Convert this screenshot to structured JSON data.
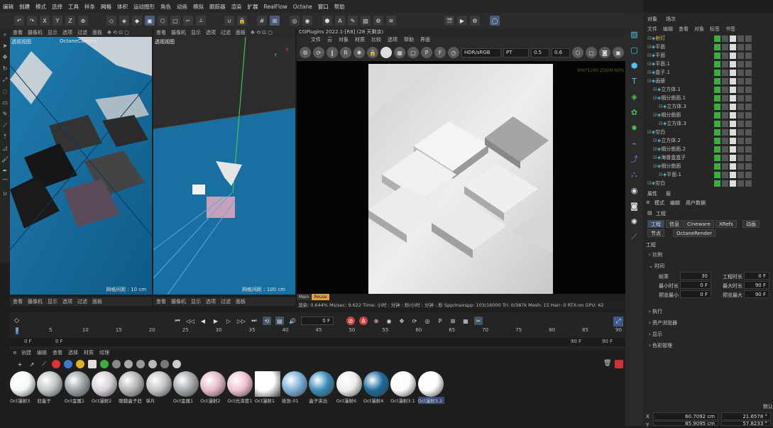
{
  "menubar": {
    "items": [
      "编辑",
      "创建",
      "模式",
      "选择",
      "工具",
      "样条",
      "网格",
      "体积",
      "运动图形",
      "角色",
      "动画",
      "模拟",
      "跟踪器",
      "渲染",
      "扩展",
      "RealFlow",
      "Octane",
      "窗口",
      "帮助"
    ]
  },
  "viewport_menu": [
    "查看",
    "摄像机",
    "显示",
    "选项",
    "过滤",
    "面板"
  ],
  "viewport1": {
    "label": "透视视图",
    "camera": "OctaneCamera",
    "grid": "网格间距 : 10 cm"
  },
  "viewport2": {
    "label": "透视视图",
    "grid": "网格间距 : 100 cm"
  },
  "render": {
    "title": "CGPlugins   2022.1-[R8] (28 天剩余)",
    "menu": [
      "文件",
      "云",
      "对象",
      "材质",
      "比较",
      "选项",
      "帮助",
      "界面"
    ],
    "color_space": "HDR/sRGB",
    "mode": "PT",
    "val1": "0.5",
    "val2": "0.6",
    "resolution": "900*1200 ZOOM:60%",
    "tabs": [
      "Main",
      "Reuse"
    ],
    "status": "渲染: 0.644%   Ms/sec: 9.622   Time: 小时 : 分钟 : 秒/小时 : 分钟 : 秒   Spp/maxspp: 103/16000   Tri: 0/387k   Mesh: 15   Hair: 0   RTX:on   GPU: 62"
  },
  "timeline": {
    "frame_current": "0 F",
    "ruler": [
      "0",
      "5",
      "10",
      "15",
      "20",
      "25",
      "30",
      "35",
      "40",
      "45",
      "50",
      "55",
      "60",
      "65",
      "70",
      "75",
      "80",
      "85",
      "90"
    ],
    "start": "0 F",
    "start2": "0 F",
    "end": "90 F",
    "end2": "90 F"
  },
  "materials_menu": [
    "创建",
    "编辑",
    "查看",
    "选择",
    "材质",
    "纹理"
  ],
  "materials": [
    {
      "name": "Oct漫射3",
      "color": "#f4f7f9"
    },
    {
      "name": "旧盒子",
      "color": "#bfc4c6"
    },
    {
      "name": "Oct金属1",
      "color": "#9aa0a4"
    },
    {
      "name": "Oct漫射2",
      "color": "#d8cfd8"
    },
    {
      "name": "眼膜盒子旧",
      "color": "#b3b3b3"
    },
    {
      "name": "单片",
      "color": "#c0c2c4"
    },
    {
      "name": "Oct金属1",
      "color": "#a4a8ab"
    },
    {
      "name": "Oct漫射2",
      "color": "#e5b8c6"
    },
    {
      "name": "Oct光泽度1",
      "color": "#f0c0d2"
    },
    {
      "name": "Oct漫射1",
      "color": "#ffffff"
    },
    {
      "name": "纸张-01",
      "color": "#7aaed8"
    },
    {
      "name": "盒子夹出",
      "color": "#3a8ab8"
    },
    {
      "name": "Oct漫射6",
      "color": "#ededea"
    },
    {
      "name": "Oct漫射4",
      "color": "#1a6a9c"
    },
    {
      "name": "Oct漫射3.1",
      "color": "#fbfbfb"
    },
    {
      "name": "Oct漫射3.2",
      "color": "#fdfdfd"
    }
  ],
  "objects": {
    "tabs": [
      "对象",
      "场次"
    ],
    "menu": [
      "文件",
      "编辑",
      "查看",
      "对象",
      "标签",
      "书签"
    ],
    "rows": [
      {
        "name": "射灯",
        "indent": 0,
        "color": "#e0c040"
      },
      {
        "name": "平面",
        "indent": 0,
        "color": "#c0c0c0"
      },
      {
        "name": "平面",
        "indent": 0,
        "color": "#c0c0c0"
      },
      {
        "name": "平面.1",
        "indent": 0,
        "color": "#c0c0c0"
      },
      {
        "name": "盒子.1",
        "indent": 0,
        "color": "#c0c0c0"
      },
      {
        "name": "画册",
        "indent": 0,
        "color": "#c0c0c0"
      },
      {
        "name": "立方体.1",
        "indent": 1,
        "color": "#c0c0c0"
      },
      {
        "name": "细分曲面.1",
        "indent": 1,
        "color": "#c0c0c0"
      },
      {
        "name": "立方体.3",
        "indent": 2,
        "color": "#c0c0c0"
      },
      {
        "name": "细分曲面",
        "indent": 1,
        "color": "#c0c0c0"
      },
      {
        "name": "立方体.3",
        "indent": 2,
        "color": "#c0c0c0"
      },
      {
        "name": "空白",
        "indent": 0,
        "color": "#c0c0c0"
      },
      {
        "name": "立方体.2",
        "indent": 1,
        "color": "#c0c0c0"
      },
      {
        "name": "细分曲面.2",
        "indent": 1,
        "color": "#c0c0c0"
      },
      {
        "name": "海普盒盒子",
        "indent": 1,
        "color": "#c0c0c0"
      },
      {
        "name": "细分曲面",
        "indent": 1,
        "color": "#c0c0c0"
      },
      {
        "name": "平面.1",
        "indent": 2,
        "color": "#c0c0c0"
      },
      {
        "name": "空白",
        "indent": 0,
        "color": "#c0c0c0"
      }
    ]
  },
  "attributes": {
    "tabs": [
      "属性",
      "层"
    ],
    "menu": [
      "模式",
      "编辑",
      "用户数据"
    ],
    "section": "工程",
    "subtitle": "工程",
    "buttons": [
      "工程",
      "信息",
      "Cineware",
      "XRefs",
      "动画"
    ],
    "buttons2": [
      "节点",
      "OctaneRender"
    ],
    "groups": [
      "比例",
      "时间",
      "执行",
      "资产浏览器",
      "显示",
      "色彩管理"
    ],
    "fields": [
      {
        "label": "帧率",
        "value": "30"
      },
      {
        "label": "最小时长",
        "value": "0 F"
      },
      {
        "label": "预览最小",
        "value": "0 F"
      }
    ],
    "fields_right": [
      {
        "label": "工程时长",
        "value": "0 F"
      },
      {
        "label": "最大时长",
        "value": "90 F"
      },
      {
        "label": "预览最大",
        "value": "90 F"
      }
    ],
    "coords": [
      {
        "axis": "X",
        "v1": "60.7092 cm",
        "v2": "21.6578 °"
      },
      {
        "axis": "Y",
        "v1": "85.9095 cm",
        "v2": "57.8233 °"
      }
    ],
    "coord_label": "默认"
  }
}
